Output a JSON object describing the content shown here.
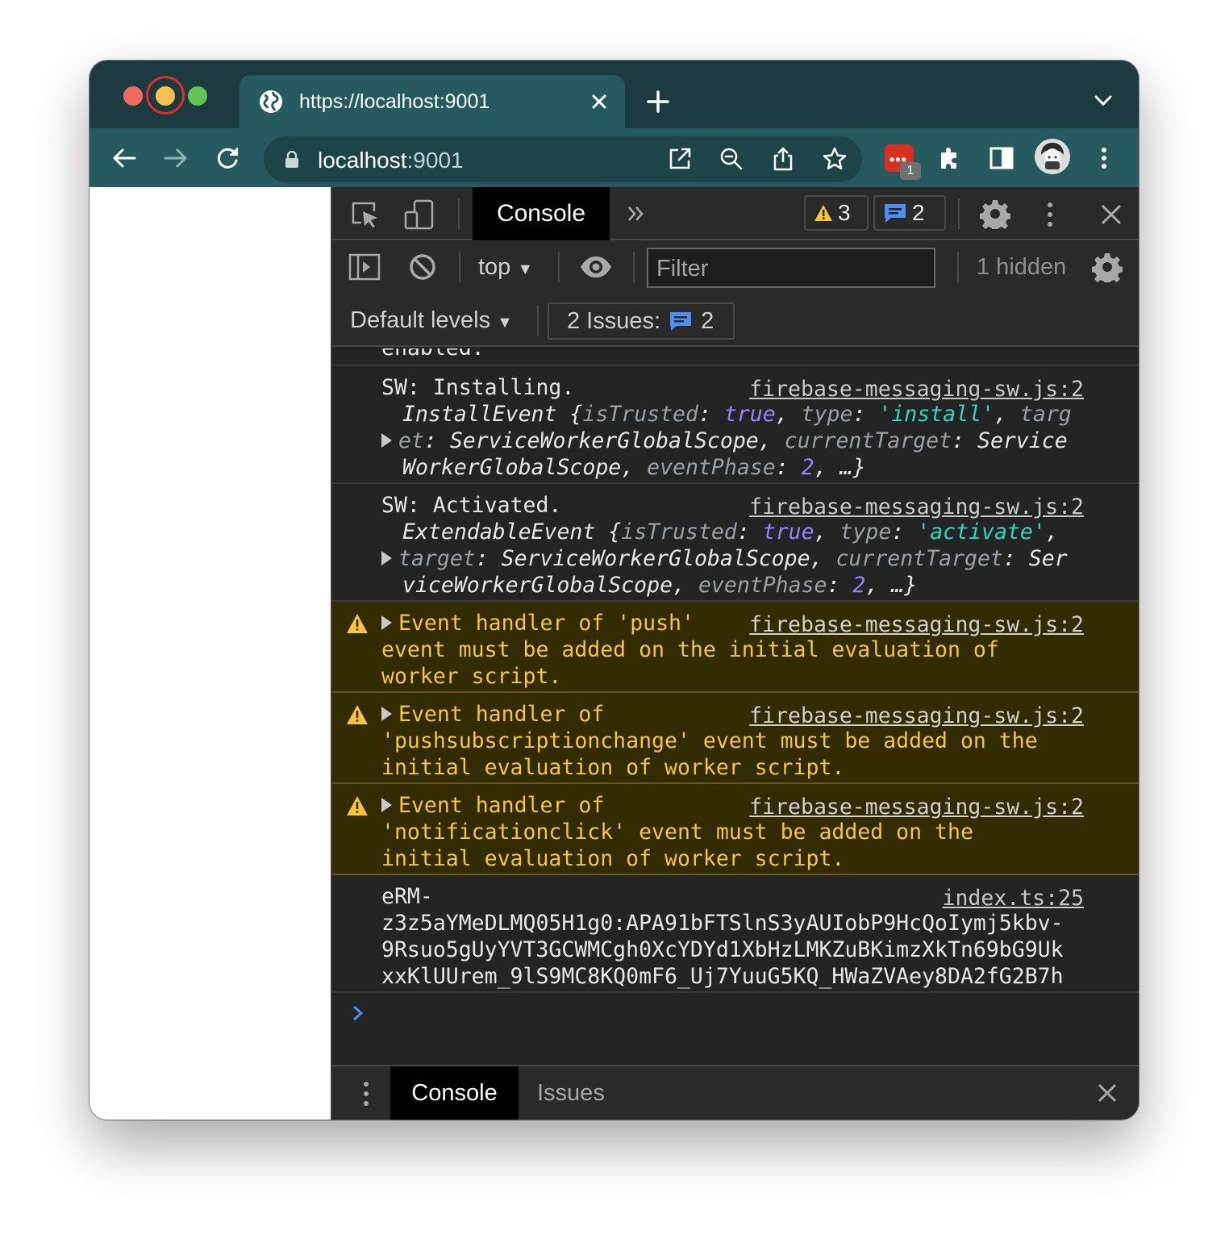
{
  "browser": {
    "tab_title": "https://localhost:9001",
    "url_host": "localhost",
    "url_port": ":9001",
    "extension_badge": "1"
  },
  "devtools": {
    "active_tab": "Console",
    "warning_count": "3",
    "info_count": "2",
    "context": "top",
    "filter_placeholder": "Filter",
    "hidden_count": "1 hidden",
    "default_levels": "Default levels",
    "issues_label": "2 Issues:",
    "issues_count": "2",
    "drawer_tabs": [
      "Console",
      "Issues"
    ]
  },
  "console": {
    "truncated": "enabled.",
    "messages": [
      {
        "type": "log",
        "text": "SW: Installing.",
        "source": "firebase-messaging-sw.js:2",
        "object_lines": [
          "InstallEvent {isTrusted: true, type: 'install', targ",
          "et: ServiceWorkerGlobalScope, currentTarget: Service",
          "WorkerGlobalScope, eventPhase: 2, …}"
        ]
      },
      {
        "type": "log",
        "text": "SW: Activated.",
        "source": "firebase-messaging-sw.js:2",
        "object_lines": [
          "ExtendableEvent {isTrusted: true, type: 'activate',",
          "target: ServiceWorkerGlobalScope, currentTarget: Ser",
          "viceWorkerGlobalScope, eventPhase: 2, …}"
        ]
      },
      {
        "type": "warning",
        "source": "firebase-messaging-sw.js:2",
        "lines": [
          "Event handler of 'push'",
          "event must be added on the initial evaluation of",
          "worker script."
        ]
      },
      {
        "type": "warning",
        "source": "firebase-messaging-sw.js:2",
        "lines": [
          "Event handler of",
          "'pushsubscriptionchange' event must be added on the",
          "initial evaluation of worker script."
        ]
      },
      {
        "type": "warning",
        "source": "firebase-messaging-sw.js:2",
        "lines": [
          "Event handler of",
          "'notificationclick' event must be added on the",
          "initial evaluation of worker script."
        ]
      },
      {
        "type": "log",
        "source": "index.ts:25",
        "lines": [
          "eRM-",
          "z3z5aYMeDLMQ05H1g0:APA91bFTSlnS3yAUIobP9HcQoIymj5kbv-",
          "9Rsuo5gUyYVT3GCWMCgh0XcYDYd1XbHzLMKZuBKimzXkTn69bG9Uk",
          "xxKlUUrem_9lS9MC8KQ0mF6_Uj7YuuG5KQ_HWaZVAey8DA2fG2B7h"
        ]
      }
    ]
  },
  "colors": {
    "tab_strip": "#1c3a40",
    "toolbar": "#245a60",
    "devtools_bg": "#242424",
    "warning_bg": "#332b02",
    "warning_text": "#f7c440"
  }
}
